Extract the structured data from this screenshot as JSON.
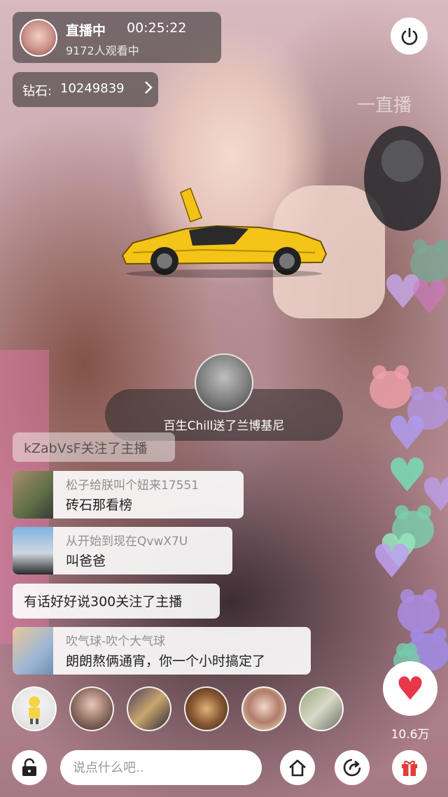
{
  "header": {
    "live_label": "直播中",
    "live_time": "00:25:22",
    "viewers": "9172人观看中",
    "diamond_label": "钻石:",
    "diamond_value": "10249839",
    "power_icon": "power-icon"
  },
  "watermark": "一直播",
  "gift": {
    "item_icon": "sports-car-icon",
    "message": "百生Chill送了兰博基尼"
  },
  "chat": [
    {
      "type": "system",
      "text": "kZabVsF关注了主播"
    },
    {
      "type": "message",
      "name": "松子给朕叫个妞来17551",
      "text": "砖石那看榜"
    },
    {
      "type": "message",
      "name": "从开始到现在QvwX7U",
      "text": "叫爸爸"
    },
    {
      "type": "system",
      "text": "有话好好说300关注了主播"
    },
    {
      "type": "message",
      "name": "吹气球-吹个大气球",
      "text": "朗朗熬俩通宵，你一个小时搞定了"
    }
  ],
  "likes": {
    "count": "10.6万",
    "icon": "heart-icon"
  },
  "comment": {
    "placeholder": "说点什么吧.."
  },
  "bottom_bar": {
    "lock_icon": "lock-icon",
    "home_icon": "home-icon",
    "share_icon": "share-icon",
    "gift_icon": "gift-box-icon"
  },
  "colors": {
    "like_red": "#e8364a",
    "gift_red": "#e23b3b",
    "overlay": "#282828"
  }
}
